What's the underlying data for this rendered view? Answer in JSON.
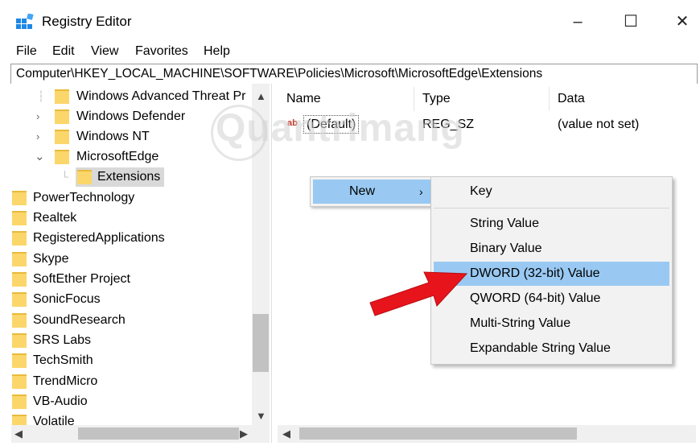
{
  "window": {
    "title": "Registry Editor",
    "controls": {
      "minimize": "–",
      "maximize": "☐",
      "close": "✕"
    }
  },
  "menu": [
    "File",
    "Edit",
    "View",
    "Favorites",
    "Help"
  ],
  "address": "Computer\\HKEY_LOCAL_MACHINE\\SOFTWARE\\Policies\\Microsoft\\MicrosoftEdge\\Extensions",
  "tree": {
    "nested": [
      {
        "label": "Windows Advanced Threat Pr",
        "expander": ""
      },
      {
        "label": "Windows Defender",
        "expander": "›"
      },
      {
        "label": "Windows NT",
        "expander": "›"
      },
      {
        "label": "MicrosoftEdge",
        "expander": "⌄"
      },
      {
        "label": "Extensions",
        "selected": true
      }
    ],
    "top_level": [
      "PowerTechnology",
      "Realtek",
      "RegisteredApplications",
      "Skype",
      "SoftEther Project",
      "SonicFocus",
      "SoundResearch",
      "SRS Labs",
      "TechSmith",
      "TrendMicro",
      "VB-Audio",
      "Volatile"
    ]
  },
  "values": {
    "columns": [
      "Name",
      "Type",
      "Data"
    ],
    "rows": [
      {
        "icon": "ab",
        "name": "(Default)",
        "type": "REG_SZ",
        "data": "(value not set)"
      }
    ]
  },
  "context_menu": {
    "item": "New",
    "arrow": "›"
  },
  "submenu": {
    "items": [
      "Key",
      "String Value",
      "Binary Value",
      "DWORD (32-bit) Value",
      "QWORD (64-bit) Value",
      "Multi-String Value",
      "Expandable String Value"
    ],
    "highlighted": "DWORD (32-bit) Value"
  },
  "watermark": "Quantrimang",
  "colors": {
    "highlight": "#99c9f2",
    "folder": "#fbd66a",
    "arrow": "#e8141b"
  }
}
